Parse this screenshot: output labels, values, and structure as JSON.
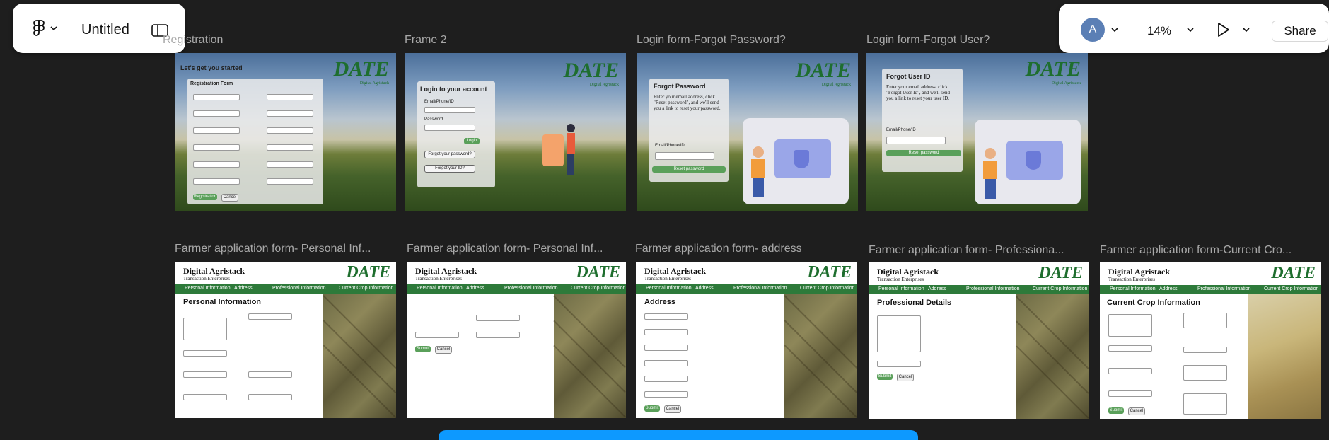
{
  "toolbar_left": {
    "file_title": "Untitled",
    "menu_icon": "figma-logo-icon",
    "chevron_icon": "chevron-down-icon",
    "sidebar_icon": "sidebar-toggle-icon"
  },
  "toolbar_right": {
    "avatar_initial": "A",
    "zoom": "14%",
    "share_label": "Share",
    "play_icon": "play-icon"
  },
  "colors": {
    "canvas": "#1e1e1e",
    "avatar": "#5b7fb5",
    "accent": "#0d99ff",
    "brand_green": "#2d7a3a"
  },
  "frames_row1": [
    {
      "label": "Registration"
    },
    {
      "label": "Frame 2"
    },
    {
      "label": "Login form-Forgot Password?"
    },
    {
      "label": "Login form-Forgot User?"
    }
  ],
  "frames_row2": [
    {
      "label": "Farmer application form- Personal Inf..."
    },
    {
      "label": "Farmer application form- Personal Inf..."
    },
    {
      "label": "Farmer application form- address"
    },
    {
      "label": "Farmer application form- Professiona..."
    },
    {
      "label": "Farmer application form-Current Cro..."
    }
  ],
  "mock": {
    "logo": "DATE",
    "logo_sub": "Digital Agristack",
    "brand_name": "Digital Agristack",
    "brand_sub": "Transaction Enterprises",
    "registration": {
      "heading": "Let's get you started",
      "card_title": "Registration Form",
      "register_btn": "Registration",
      "cancel_btn": "Cancel"
    },
    "login": {
      "title": "Login to your account",
      "email_label": "Email/Phone/ID",
      "password_label": "Password",
      "login_btn": "Login",
      "forgot_password_btn": "Forgot your password?",
      "forgot_id_btn": "Forgot your ID?"
    },
    "forgot_password": {
      "title": "Forgot Password",
      "text": "Enter your email address, click \"Reset password\", and we'll send you a link to reset your password.",
      "email_label": "Email/Phone/ID",
      "btn": "Reset password"
    },
    "forgot_user": {
      "title": "Forgot User ID",
      "text": "Enter your email address, click \"Forgot User Id\", and we'll send you a link to reset your user ID.",
      "email_label": "Email/Phone/ID",
      "btn": "Reset password"
    },
    "nav": {
      "personal": "Personal Information",
      "address": "Address",
      "professional": "Professional Information",
      "crop": "Current Crop Information"
    },
    "sections": {
      "personal": "Personal Information",
      "address": "Address",
      "professional": "Professional Details",
      "crop": "Current Crop Information"
    },
    "buttons": {
      "submit": "Submit",
      "cancel": "Cancel"
    }
  }
}
